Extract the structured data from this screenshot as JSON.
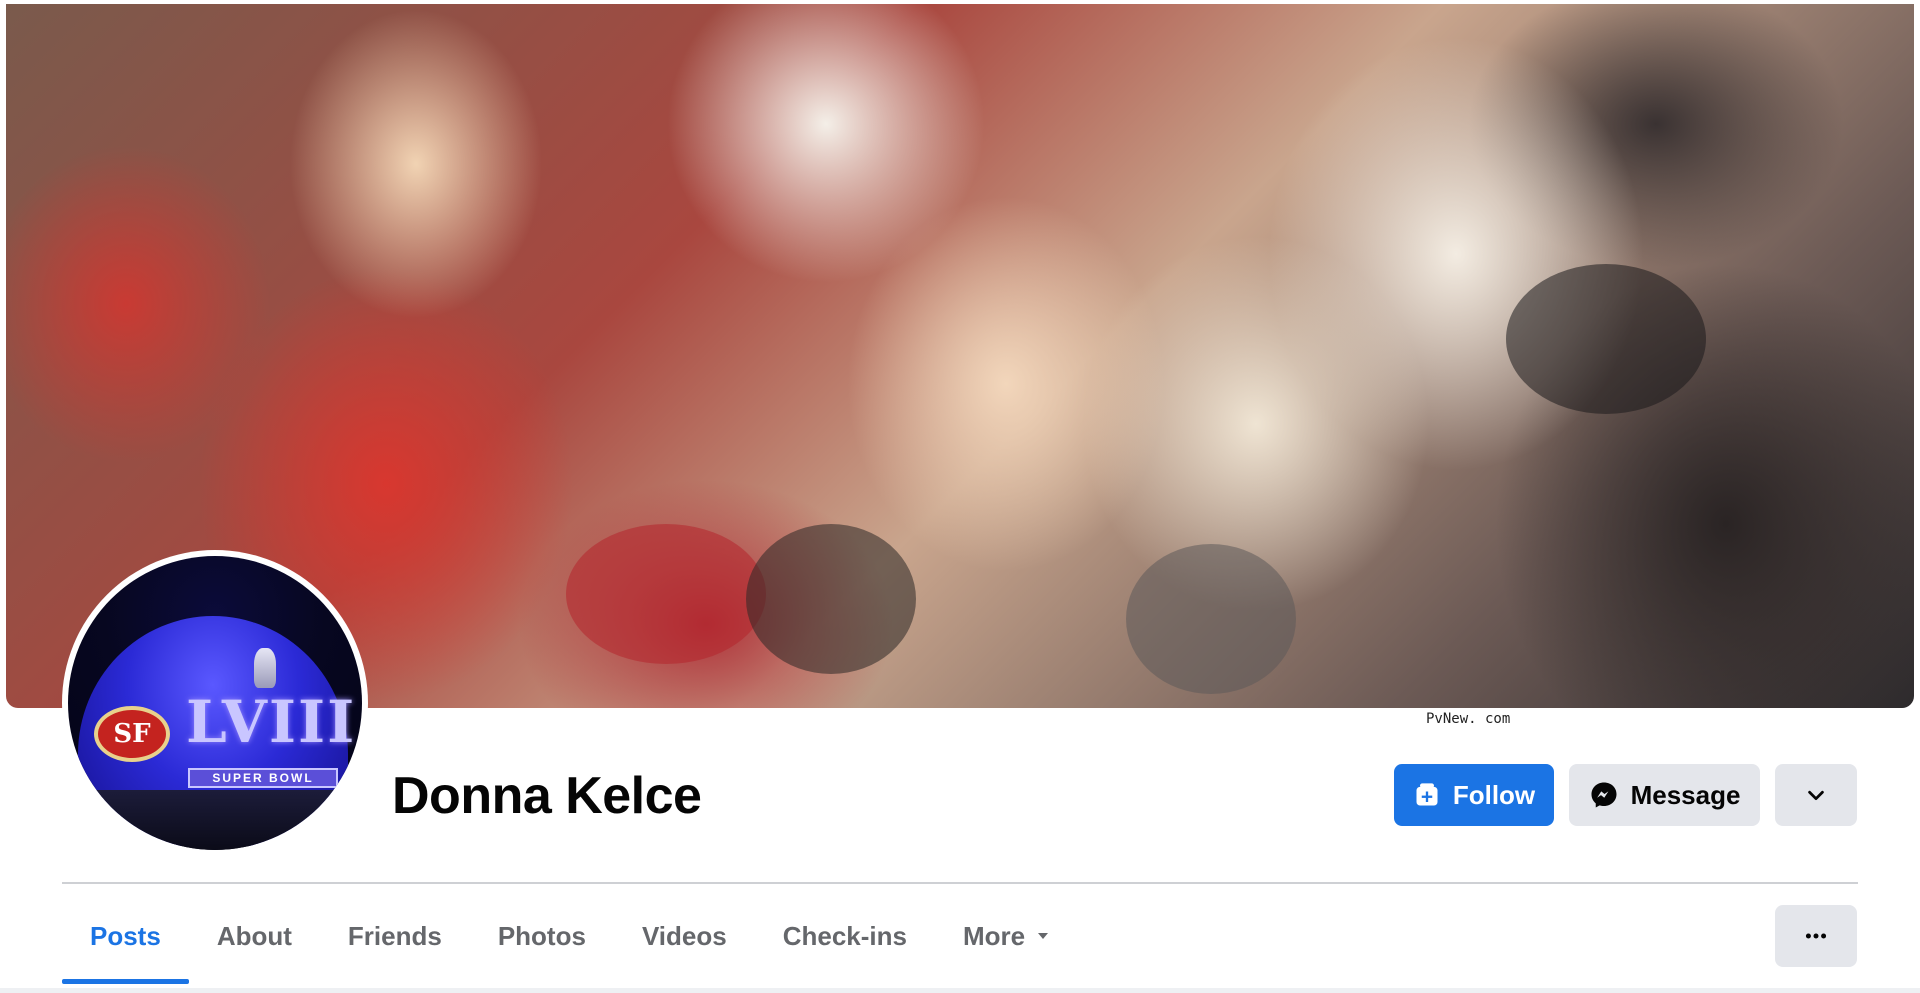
{
  "cover": {
    "watermark": "PvNew. com"
  },
  "profile": {
    "name": "Donna Kelce",
    "avatar": {
      "badge": "SF",
      "numerals": "LVIII",
      "banner": "SUPER BOWL"
    }
  },
  "actions": {
    "follow_label": "Follow",
    "message_label": "Message"
  },
  "tabs": [
    {
      "label": "Posts",
      "active": true
    },
    {
      "label": "About",
      "active": false
    },
    {
      "label": "Friends",
      "active": false
    },
    {
      "label": "Photos",
      "active": false
    },
    {
      "label": "Videos",
      "active": false
    },
    {
      "label": "Check-ins",
      "active": false
    },
    {
      "label": "More",
      "active": false
    }
  ],
  "colors": {
    "accent": "#1b74e4",
    "button_gray": "#e4e6eb",
    "muted_text": "#65676b"
  },
  "icons": {
    "follow": "follow-add-icon",
    "message": "messenger-icon",
    "more": "chevron-down-icon",
    "tab_more": "caret-down-icon",
    "overflow": "ellipsis-icon"
  }
}
